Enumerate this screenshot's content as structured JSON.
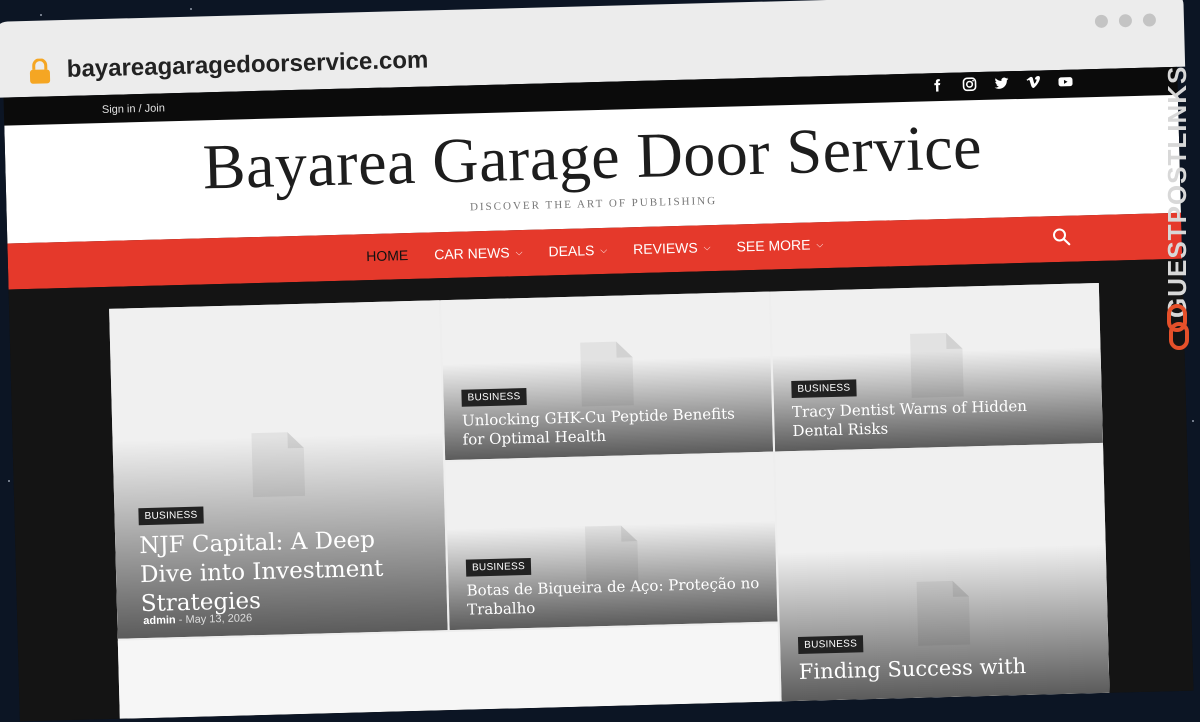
{
  "browser": {
    "url": "bayareagaragedoorservice.com"
  },
  "topbar": {
    "signin_label": "Sign in / Join",
    "social_icons": [
      "facebook-icon",
      "instagram-icon",
      "twitter-icon",
      "vimeo-icon",
      "youtube-icon"
    ]
  },
  "header": {
    "site_title": "Bayarea Garage Door Service",
    "tagline": "DISCOVER THE ART OF PUBLISHING"
  },
  "nav": {
    "items": [
      {
        "label": "HOME",
        "active": true
      },
      {
        "label": "CAR NEWS"
      },
      {
        "label": "DEALS"
      },
      {
        "label": "REVIEWS"
      },
      {
        "label": "SEE MORE"
      }
    ]
  },
  "posts": [
    {
      "category": "BUSINESS",
      "title": "NJF Capital: A Deep Dive into Investment Strategies",
      "author": "admin",
      "separator": "-",
      "date": "May 13, 2026"
    },
    {
      "category": "BUSINESS",
      "title": "Unlocking GHK-Cu Peptide Benefits for Optimal Health"
    },
    {
      "category": "BUSINESS",
      "title": "Tracy Dentist Warns of Hidden Dental Risks"
    },
    {
      "category": "BUSINESS",
      "title": "Botas de Biqueira de Aço: Proteção no Trabalho"
    },
    {
      "category": "BUSINESS",
      "title": "Finding Success with"
    }
  ],
  "watermark": {
    "text": "GUESTPOSTLINKS"
  },
  "colors": {
    "accent": "#e5392b",
    "topbar": "#0b0b0b",
    "background": "#0c1524"
  }
}
